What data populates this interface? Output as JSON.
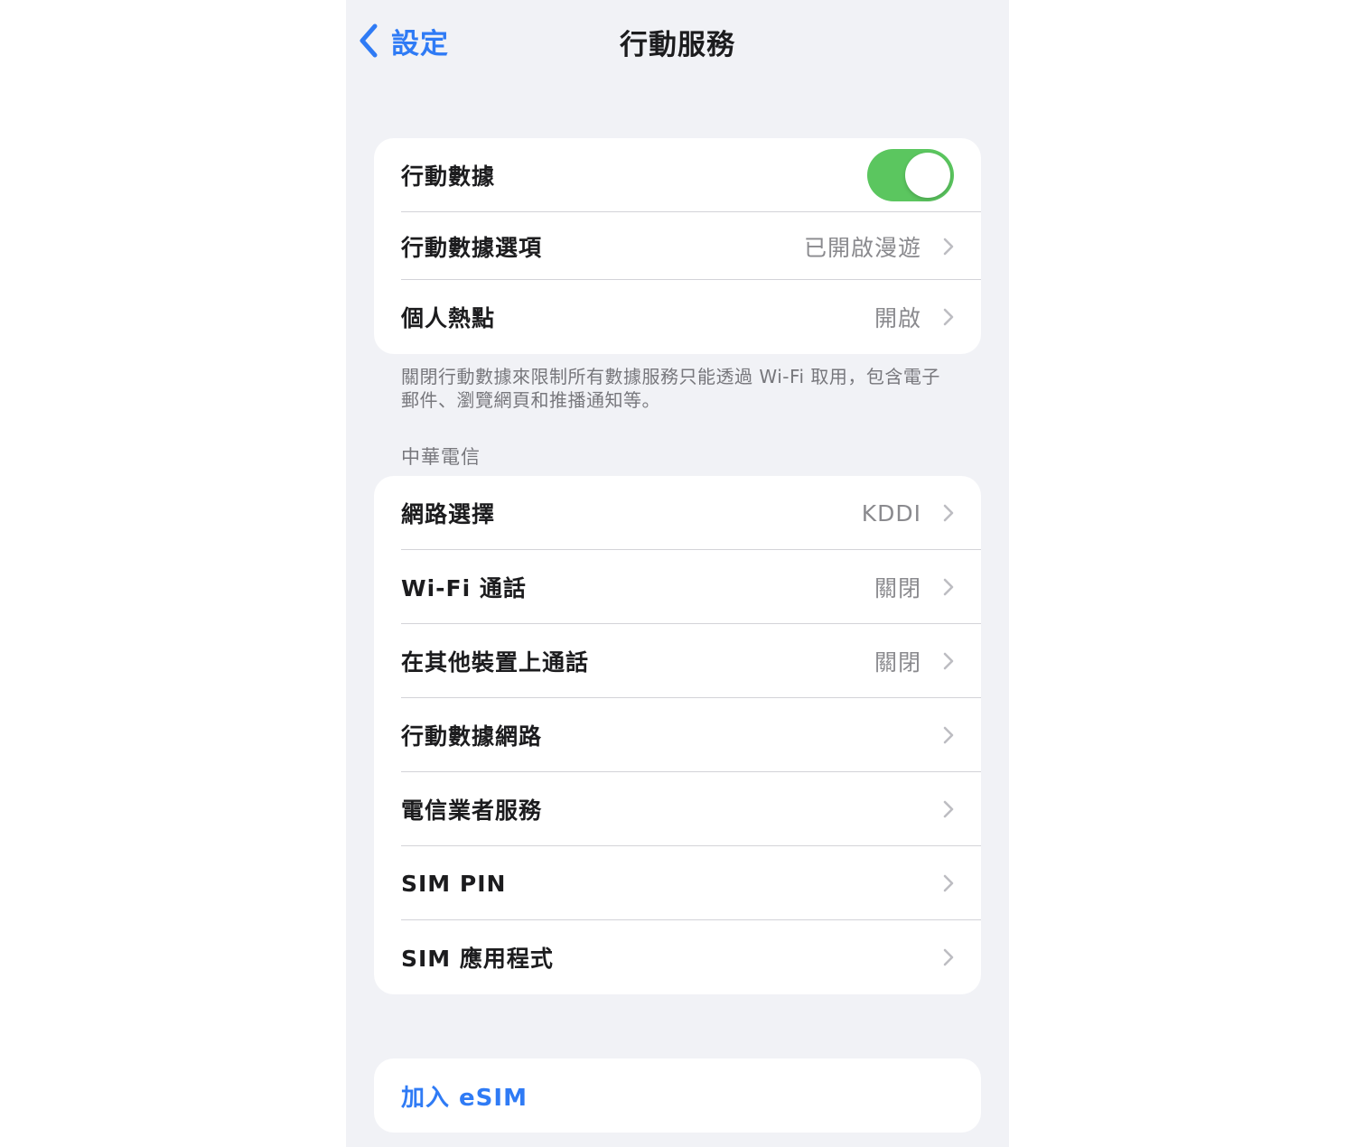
{
  "navbar": {
    "back_label": "設定",
    "title": "行動服務"
  },
  "group1": {
    "rows": [
      {
        "label": "行動數據",
        "toggle_on": true
      },
      {
        "label": "行動數據選項",
        "value": "已開啟漫遊"
      },
      {
        "label": "個人熱點",
        "value": "開啟"
      }
    ],
    "footnote": "關閉行動數據來限制所有數據服務只能透過 Wi-Fi 取用，包含電子郵件、瀏覽網頁和推播通知等。"
  },
  "carrier_section": {
    "header": "中華電信",
    "rows": [
      {
        "label": "網路選擇",
        "value": "KDDI"
      },
      {
        "label": "Wi-Fi 通話",
        "value": "關閉"
      },
      {
        "label": "在其他裝置上通話",
        "value": "關閉"
      },
      {
        "label": "行動數據網路"
      },
      {
        "label": "電信業者服務"
      },
      {
        "label": "SIM PIN"
      },
      {
        "label": "SIM 應用程式"
      }
    ]
  },
  "esim": {
    "label": "加入 eSIM"
  },
  "colors": {
    "accent": "#2f7bf5",
    "toggle_on": "#5bc65f",
    "background": "#f1f2f6"
  },
  "icons": {
    "back": "chevron-left-icon",
    "disclosure": "chevron-right-icon"
  }
}
